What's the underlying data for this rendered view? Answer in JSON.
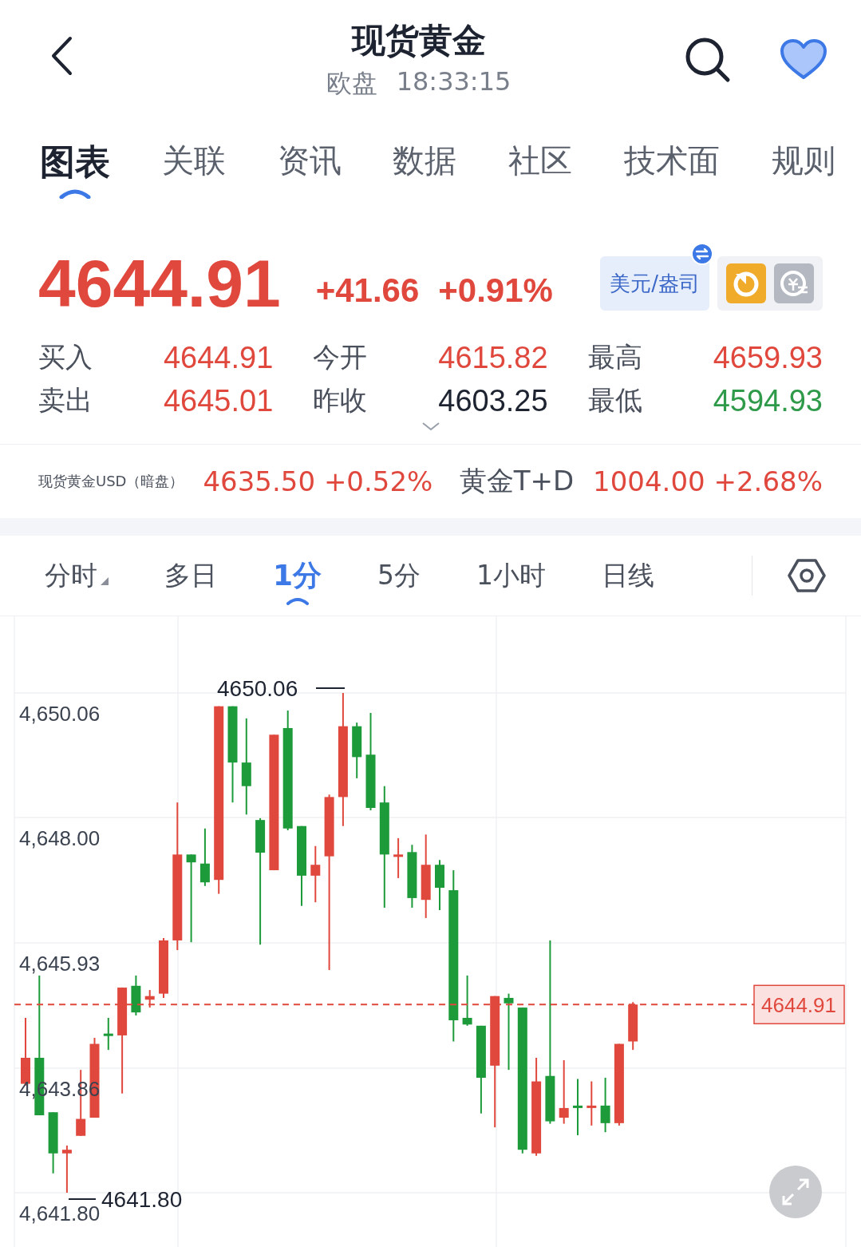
{
  "header": {
    "title": "现货黄金",
    "session": "欧盘",
    "time": "18:33:15",
    "favorite": true
  },
  "tabs": [
    {
      "label": "图表",
      "selected": true
    },
    {
      "label": "关联",
      "selected": false
    },
    {
      "label": "资讯",
      "selected": false
    },
    {
      "label": "数据",
      "selected": false
    },
    {
      "label": "社区",
      "selected": false
    },
    {
      "label": "技术面",
      "selected": false
    },
    {
      "label": "规则",
      "selected": false
    }
  ],
  "quote": {
    "price": "4644.91",
    "change": "+41.66",
    "change_pct": "+0.91%",
    "color": "#e0483d",
    "unit": "美元/盎司"
  },
  "stats": [
    {
      "label": "买入",
      "value": "4644.91",
      "color": "#e0483d"
    },
    {
      "label": "今开",
      "value": "4615.82",
      "color": "#e0483d"
    },
    {
      "label": "最高",
      "value": "4659.93",
      "color": "#e0483d"
    },
    {
      "label": "卖出",
      "value": "4645.01",
      "color": "#e0483d"
    },
    {
      "label": "昨收",
      "value": "4603.25",
      "color": "#1d2330"
    },
    {
      "label": "最低",
      "value": "4594.93",
      "color": "#2e9a4a"
    }
  ],
  "related": [
    {
      "name": "现货黄金USD（暗盘）",
      "kind": "small",
      "price": "4635.50",
      "change_pct": "+0.52%",
      "color": "#e0483d"
    },
    {
      "name": "黄金T+D",
      "kind": "large",
      "price": "1004.00",
      "change_pct": "+2.68%",
      "color": "#e0483d"
    }
  ],
  "periods": [
    {
      "label": "分时",
      "selected": false,
      "dropdown": true
    },
    {
      "label": "多日",
      "selected": false,
      "dropdown": false
    },
    {
      "label": "1分",
      "selected": true,
      "dropdown": false
    },
    {
      "label": "5分",
      "selected": false,
      "dropdown": false
    },
    {
      "label": "1小时",
      "selected": false,
      "dropdown": false
    },
    {
      "label": "日线",
      "selected": false,
      "dropdown": false
    }
  ],
  "chart": {
    "high_label": "4650.06",
    "low_label": "4641.80",
    "chart_data": {
      "type": "candlestick",
      "ylim": [
        4641.8,
        4650.06
      ],
      "grid": true,
      "ref_lines": [
        {
          "axis": "y",
          "value": 4644.91,
          "label": "4644.91",
          "color": "#e0483d"
        }
      ],
      "yticks": [
        {
          "value": 4650.06,
          "label": "4,650.06"
        },
        {
          "value": 4648.0,
          "label": "4,648.00"
        },
        {
          "value": 4645.93,
          "label": "4,645.93"
        },
        {
          "value": 4643.86,
          "label": "4,643.86"
        },
        {
          "value": 4641.8,
          "label": "4,641.80"
        }
      ],
      "ohlc": [
        [
          4643.6,
          4644.69,
          4643.57,
          4644.03
        ],
        [
          4644.03,
          4645.39,
          4643.08,
          4643.08
        ],
        [
          4643.13,
          4643.13,
          4642.12,
          4642.45
        ],
        [
          4642.45,
          4642.58,
          4641.8,
          4642.51
        ],
        [
          4642.74,
          4643.83,
          4642.74,
          4643.02
        ],
        [
          4643.04,
          4644.36,
          4643.04,
          4644.26
        ],
        [
          4644.43,
          4644.69,
          4644.16,
          4644.39
        ],
        [
          4644.4,
          4645.19,
          4643.44,
          4645.19
        ],
        [
          4645.22,
          4645.39,
          4644.73,
          4644.78
        ],
        [
          4644.99,
          4645.15,
          4644.86,
          4645.05
        ],
        [
          4645.09,
          4646.01,
          4645.02,
          4645.97
        ],
        [
          4645.97,
          4648.25,
          4645.81,
          4647.39
        ],
        [
          4647.39,
          4647.39,
          4645.94,
          4647.26
        ],
        [
          4647.24,
          4647.82,
          4646.87,
          4646.93
        ],
        [
          4646.97,
          4649.84,
          4646.74,
          4649.84
        ],
        [
          4649.84,
          4649.84,
          4648.25,
          4648.91
        ],
        [
          4648.91,
          4649.64,
          4648.05,
          4648.52
        ],
        [
          4647.96,
          4647.99,
          4645.9,
          4647.42
        ],
        [
          4647.13,
          4649.37,
          4647.13,
          4649.37
        ],
        [
          4649.48,
          4649.77,
          4647.79,
          4647.82
        ],
        [
          4647.86,
          4647.86,
          4646.54,
          4647.04
        ],
        [
          4647.04,
          4647.53,
          4646.6,
          4647.22
        ],
        [
          4647.36,
          4648.38,
          4645.48,
          4648.34
        ],
        [
          4648.34,
          4650.06,
          4647.86,
          4649.51
        ],
        [
          4649.51,
          4649.57,
          4648.65,
          4649.0
        ],
        [
          4649.04,
          4649.73,
          4648.12,
          4648.16
        ],
        [
          4648.25,
          4648.52,
          4646.51,
          4647.39
        ],
        [
          4647.36,
          4647.66,
          4647.0,
          4647.39
        ],
        [
          4647.43,
          4647.55,
          4646.51,
          4646.67
        ],
        [
          4646.64,
          4647.72,
          4646.34,
          4647.22
        ],
        [
          4647.22,
          4647.3,
          4646.47,
          4646.84
        ],
        [
          4646.8,
          4647.13,
          4644.3,
          4644.65
        ],
        [
          4644.69,
          4645.39,
          4644.56,
          4644.58
        ],
        [
          4644.56,
          4644.56,
          4643.11,
          4643.7
        ],
        [
          4643.9,
          4645.05,
          4642.88,
          4645.05
        ],
        [
          4645.02,
          4645.09,
          4643.83,
          4644.93
        ],
        [
          4644.86,
          4644.86,
          4642.45,
          4642.51
        ],
        [
          4642.45,
          4644.03,
          4642.41,
          4643.64
        ],
        [
          4643.73,
          4645.97,
          4642.94,
          4642.98
        ],
        [
          4643.04,
          4643.99,
          4642.94,
          4643.2
        ],
        [
          4643.24,
          4643.68,
          4642.75,
          4643.2
        ],
        [
          4643.2,
          4643.64,
          4642.91,
          4643.24
        ],
        [
          4643.24,
          4643.7,
          4642.8,
          4642.95
        ],
        [
          4642.95,
          4644.26,
          4642.91,
          4644.26
        ],
        [
          4644.3,
          4644.95,
          4644.16,
          4644.91
        ]
      ]
    }
  }
}
